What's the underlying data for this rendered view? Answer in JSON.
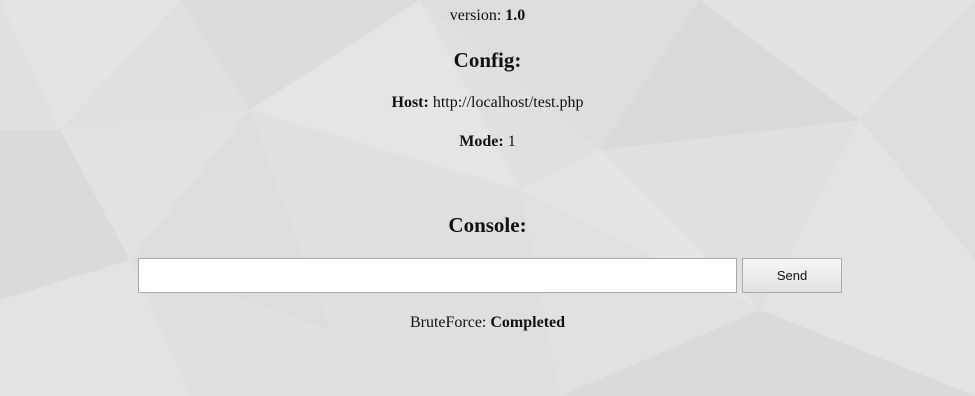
{
  "version": {
    "label": "version:",
    "value": "1.0"
  },
  "config": {
    "heading": "Config:",
    "host_label": "Host:",
    "host_value": "http://localhost/test.php",
    "mode_label": "Mode:",
    "mode_value": "1"
  },
  "console": {
    "heading": "Console:",
    "input_value": "",
    "send_label": "Send"
  },
  "status": {
    "label": "BruteForce:",
    "value": "Completed"
  },
  "colors": {
    "background": "#dfe0df",
    "text": "#111111",
    "input_border": "#a9a9a9"
  }
}
